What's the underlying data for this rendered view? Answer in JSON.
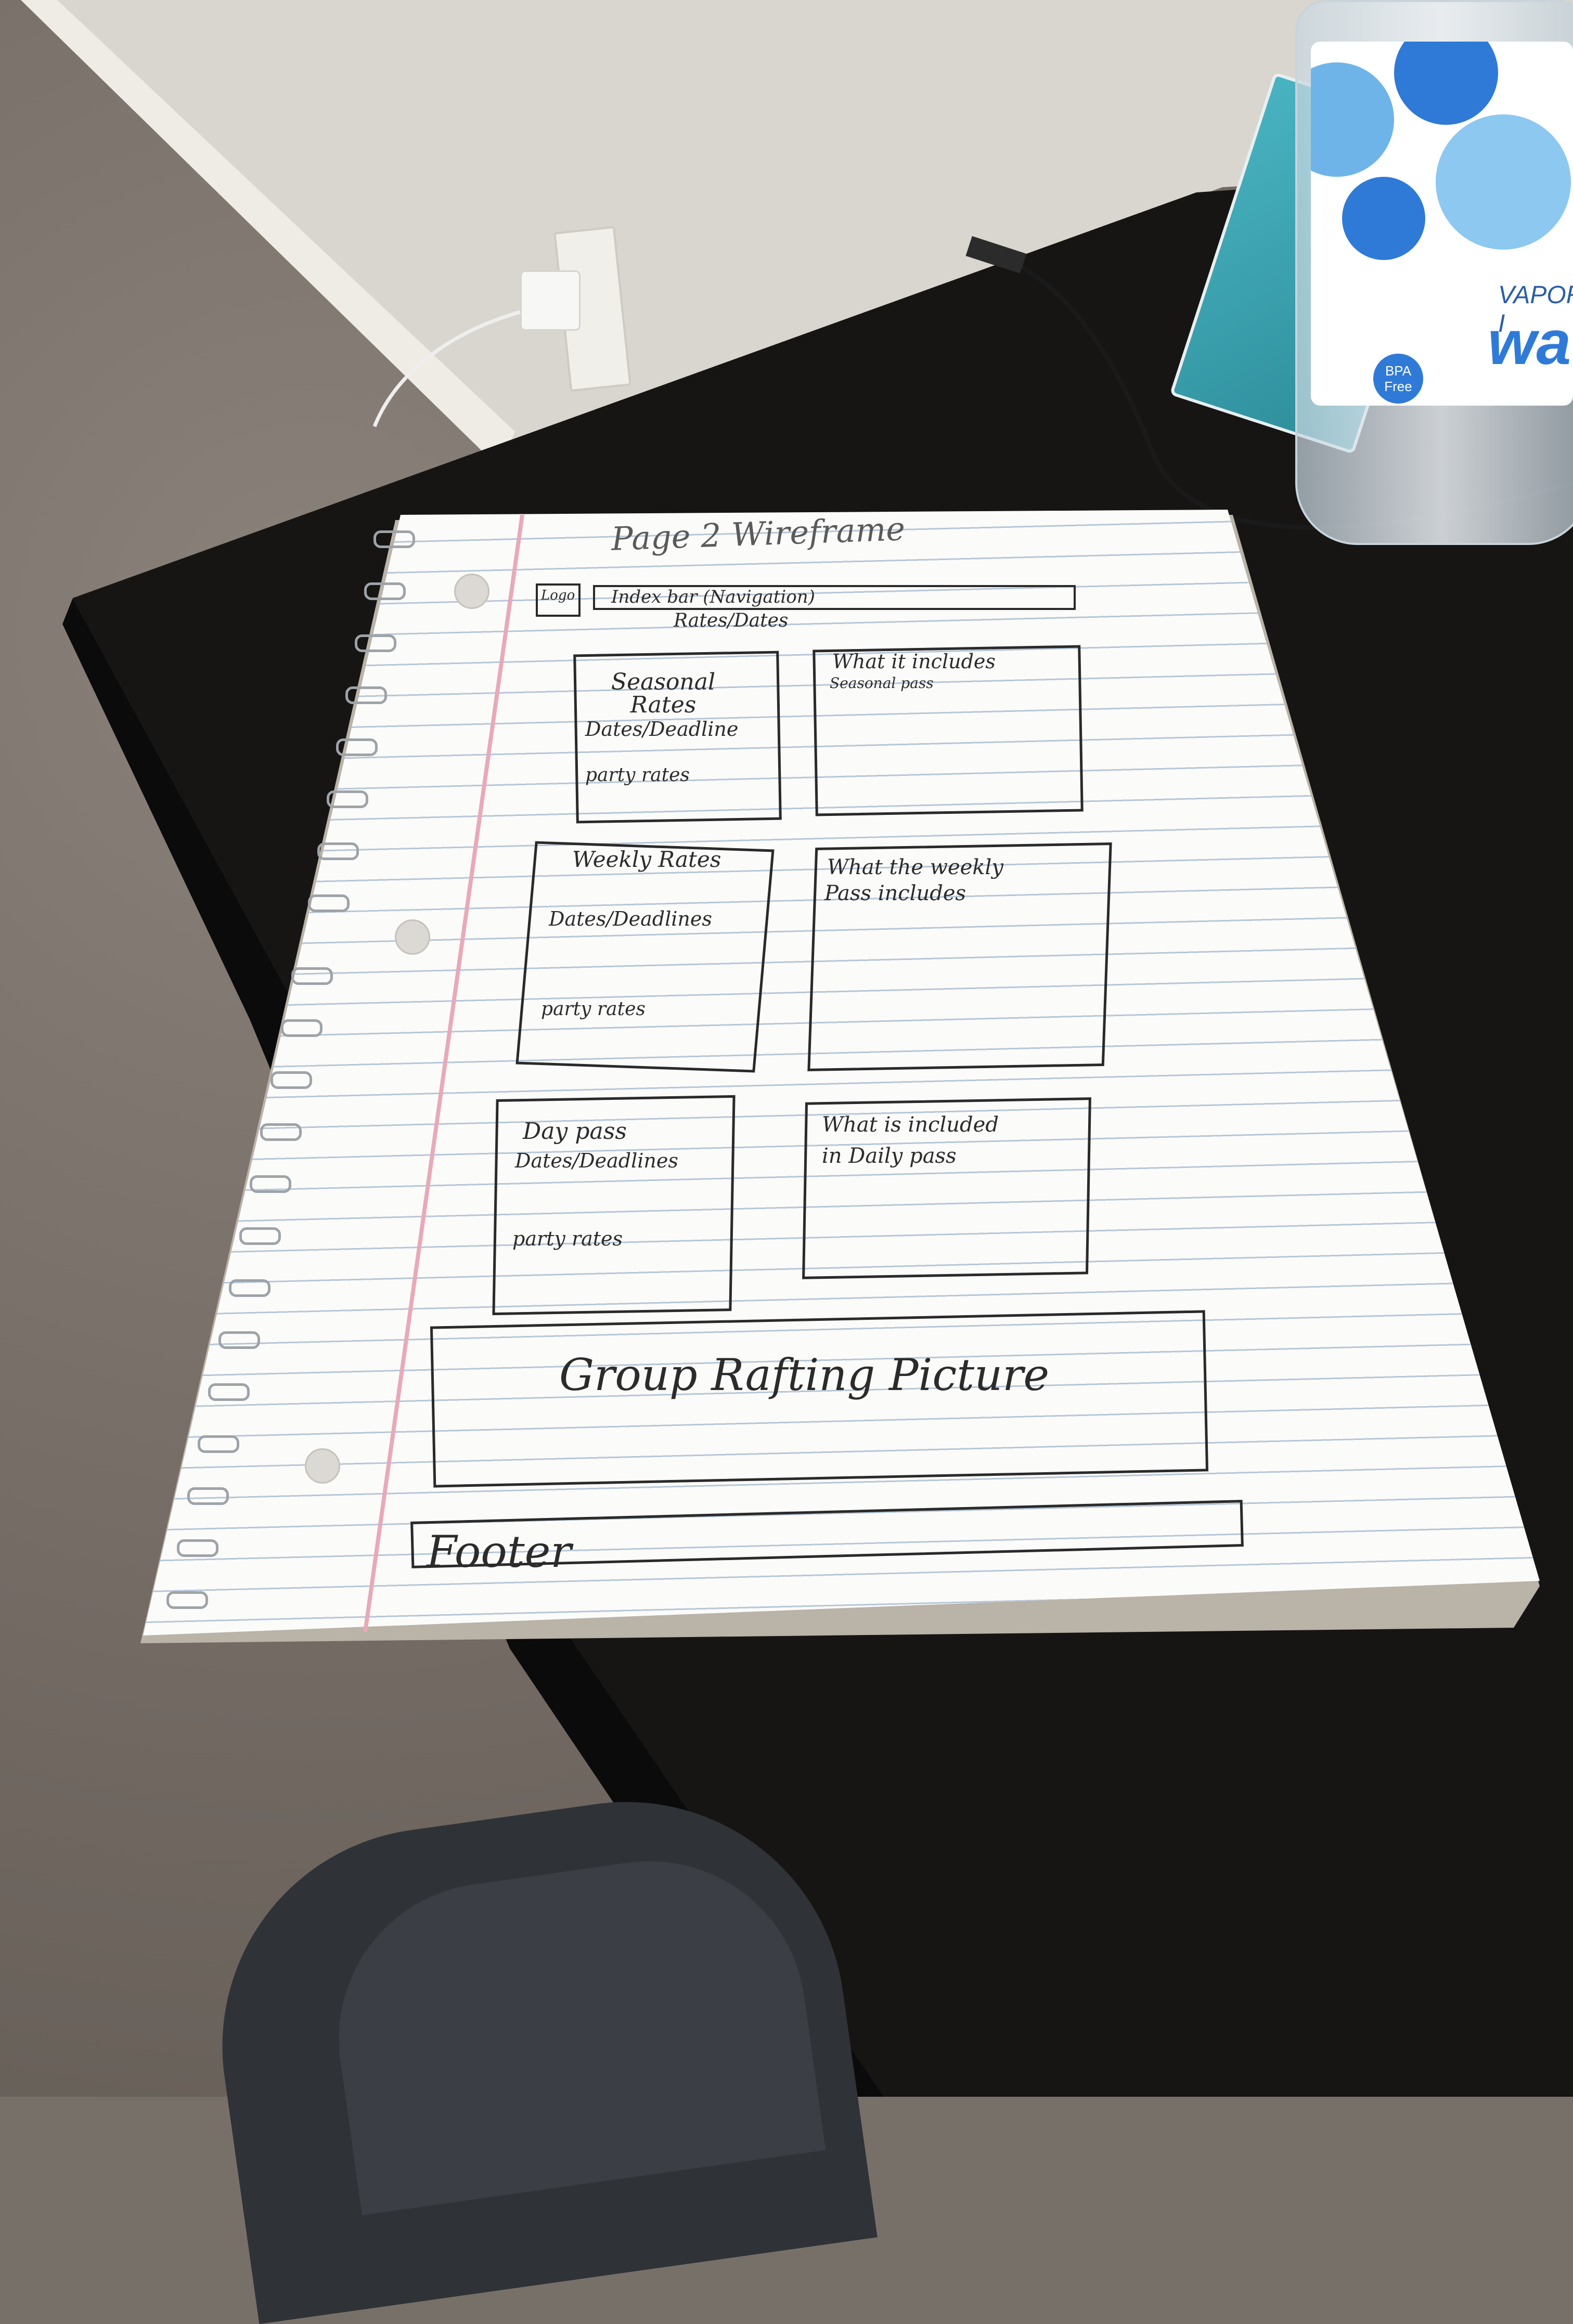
{
  "wireframe": {
    "page_title": "Page 2 Wireframe",
    "header": {
      "logo": "Logo",
      "nav_bar": "Index bar (Navigation)",
      "subtitle": "Rates/Dates"
    },
    "rows": [
      {
        "left": {
          "title": "Seasonal Rates",
          "line2": "Dates/Deadline",
          "line3": "party rates"
        },
        "right": {
          "title": "What it includes",
          "line2": "Seasonal pass"
        }
      },
      {
        "left": {
          "title": "Weekly Rates",
          "line2": "Dates/Deadlines",
          "line3": "party rates"
        },
        "right": {
          "title": "What the weekly",
          "line2": "Pass includes"
        }
      },
      {
        "left": {
          "title": "Day pass",
          "line2": "Dates/Deadlines",
          "line3": "party rates"
        },
        "right": {
          "title": "What is included",
          "line2": "in Daily pass"
        }
      }
    ],
    "banner": "Group Rafting Picture",
    "footer": "Footer"
  },
  "scene": {
    "bottle_brand_line1": "VAPOR I",
    "bottle_brand_line2": "wat",
    "bottle_badge": "BPA Free",
    "colors": {
      "desk": "#161514",
      "paper": "#fbfbfa",
      "ink": "#2b2b2b",
      "bottle_blue": "#2f7ad6",
      "tissue_teal": "#49b3c1"
    }
  }
}
